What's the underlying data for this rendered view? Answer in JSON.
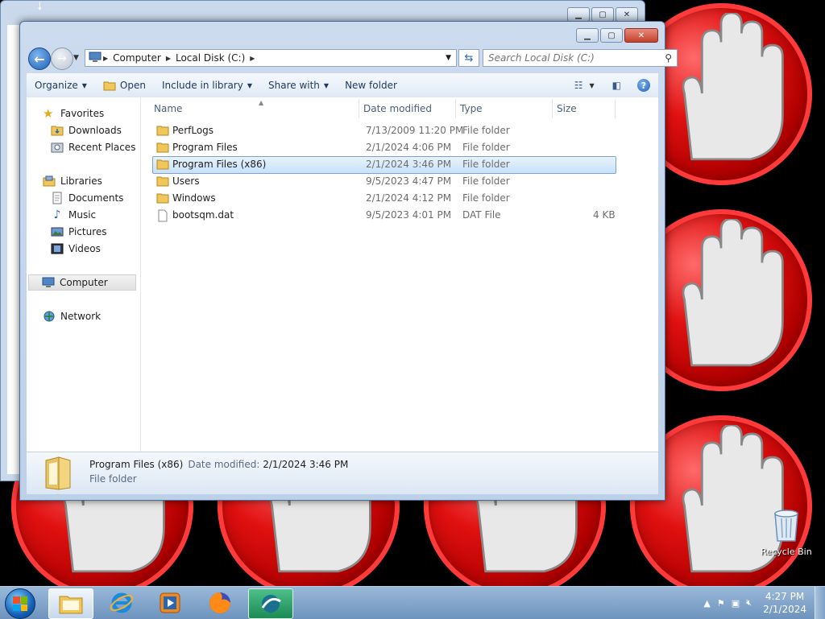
{
  "explorer": {
    "address": {
      "crumbs": [
        "Computer",
        "Local Disk (C:)"
      ]
    },
    "search": {
      "placeholder": "Search Local Disk (C:)"
    },
    "toolbar": {
      "organize": "Organize",
      "open": "Open",
      "include_in_library": "Include in library",
      "share_with": "Share with",
      "new_folder": "New folder"
    },
    "nav": {
      "favorites": "Favorites",
      "downloads": "Downloads",
      "recent_places": "Recent Places",
      "libraries": "Libraries",
      "documents": "Documents",
      "music": "Music",
      "pictures": "Pictures",
      "videos": "Videos",
      "computer": "Computer",
      "network": "Network"
    },
    "columns": {
      "name": "Name",
      "date": "Date modified",
      "type": "Type",
      "size": "Size"
    },
    "files": [
      {
        "name": "PerfLogs",
        "date": "7/13/2009 11:20 PM",
        "type": "File folder",
        "size": ""
      },
      {
        "name": "Program Files",
        "date": "2/1/2024 4:06 PM",
        "type": "File folder",
        "size": ""
      },
      {
        "name": "Program Files (x86)",
        "date": "2/1/2024 3:46 PM",
        "type": "File folder",
        "size": ""
      },
      {
        "name": "Users",
        "date": "9/5/2023 4:47 PM",
        "type": "File folder",
        "size": ""
      },
      {
        "name": "Windows",
        "date": "2/1/2024 4:12 PM",
        "type": "File folder",
        "size": ""
      },
      {
        "name": "bootsqm.dat",
        "date": "9/5/2023 4:01 PM",
        "type": "DAT File",
        "size": "4 KB"
      }
    ],
    "details": {
      "name": "Program Files (x86)",
      "date_label": "Date modified:",
      "date": "2/1/2024 3:46 PM",
      "type": "File folder"
    }
  },
  "desktop": {
    "recycle_bin": "Recycle Bin"
  },
  "taskbar": {
    "time": "4:27 PM",
    "date": "2/1/2024"
  },
  "colors": {
    "selection": "#c9e1fa",
    "stop_red": "#e01010",
    "taskbar": "#6d93bd"
  }
}
